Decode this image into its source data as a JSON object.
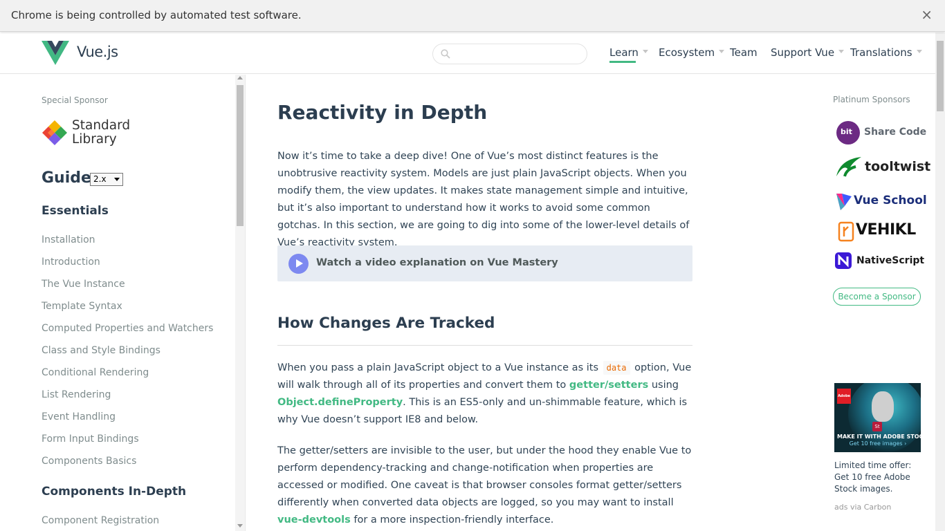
{
  "infobar": {
    "message": "Chrome is being controlled by automated test software.",
    "close": "×"
  },
  "header": {
    "logo_text": "Vue.js",
    "search_placeholder": "",
    "nav": {
      "learn": "Learn",
      "ecosystem": "Ecosystem",
      "team": "Team",
      "support": "Support Vue",
      "translations": "Translations"
    }
  },
  "sidebar": {
    "special_sponsor_label": "Special Sponsor",
    "sponsor_name_line1": "Standard",
    "sponsor_name_line2": "Library",
    "guide_title": "Guide",
    "version": "2.x",
    "sections": [
      {
        "title": "Essentials",
        "links": [
          "Installation",
          "Introduction",
          "The Vue Instance",
          "Template Syntax",
          "Computed Properties and Watchers",
          "Class and Style Bindings",
          "Conditional Rendering",
          "List Rendering",
          "Event Handling",
          "Form Input Bindings",
          "Components Basics"
        ]
      },
      {
        "title": "Components In-Depth",
        "links": [
          "Component Registration"
        ]
      }
    ]
  },
  "main": {
    "title": "Reactivity in Depth",
    "intro": "Now it’s time to take a deep dive! One of Vue’s most distinct features is the unobtrusive reactivity system. Models are just plain JavaScript objects. When you modify them, the view updates. It makes state management simple and intuitive, but it’s also important to understand how it works to avoid some common gotchas. In this section, we are going to dig into some of the lower-level details of Vue’s reactivity system.",
    "video_link": "Watch a video explanation on Vue Mastery",
    "section_title": "How Changes Are Tracked",
    "p1": {
      "a": "When you pass a plain JavaScript object to a Vue instance as its ",
      "code": "data",
      "b": " option, Vue will walk through all of its properties and convert them to ",
      "link1": "getter/setters",
      "c": " using ",
      "link2": "Object.defineProperty",
      "d": ". This is an ES5-only and un-shimmable feature, which is why Vue doesn’t support IE8 and below."
    },
    "p2": {
      "a": "The getter/setters are invisible to the user, but under the hood they enable Vue to perform dependency-tracking and change-notification when properties are accessed or modified. One caveat is that browser consoles format getter/setters differently when converted data objects are logged, so you may want to install ",
      "link": "vue-devtools",
      "b": " for a more inspection-friendly interface."
    }
  },
  "right": {
    "platinum_label": "Platinum Sponsors",
    "sponsors": {
      "bit_badge": "bit",
      "bit": "Share Code",
      "tooltwist": "tooltwist",
      "vueschool": "Vue School",
      "vehikl": "VEHIKL",
      "nativescript": "NativeScript"
    },
    "become_sponsor": "Become a Sponsor",
    "ad": {
      "badge": "Adobe",
      "st": "St",
      "line1": "MAKE IT WITH ADOBE STOCK.",
      "line2": "Get 10 free images ›",
      "text": "Limited time offer: Get 10 free Adobe Stock images.",
      "via": "ads via Carbon"
    }
  },
  "colors": {
    "accent": "#42b983",
    "heading": "#2c3e50",
    "muted": "#7f8c8d",
    "code": "#e96900"
  }
}
